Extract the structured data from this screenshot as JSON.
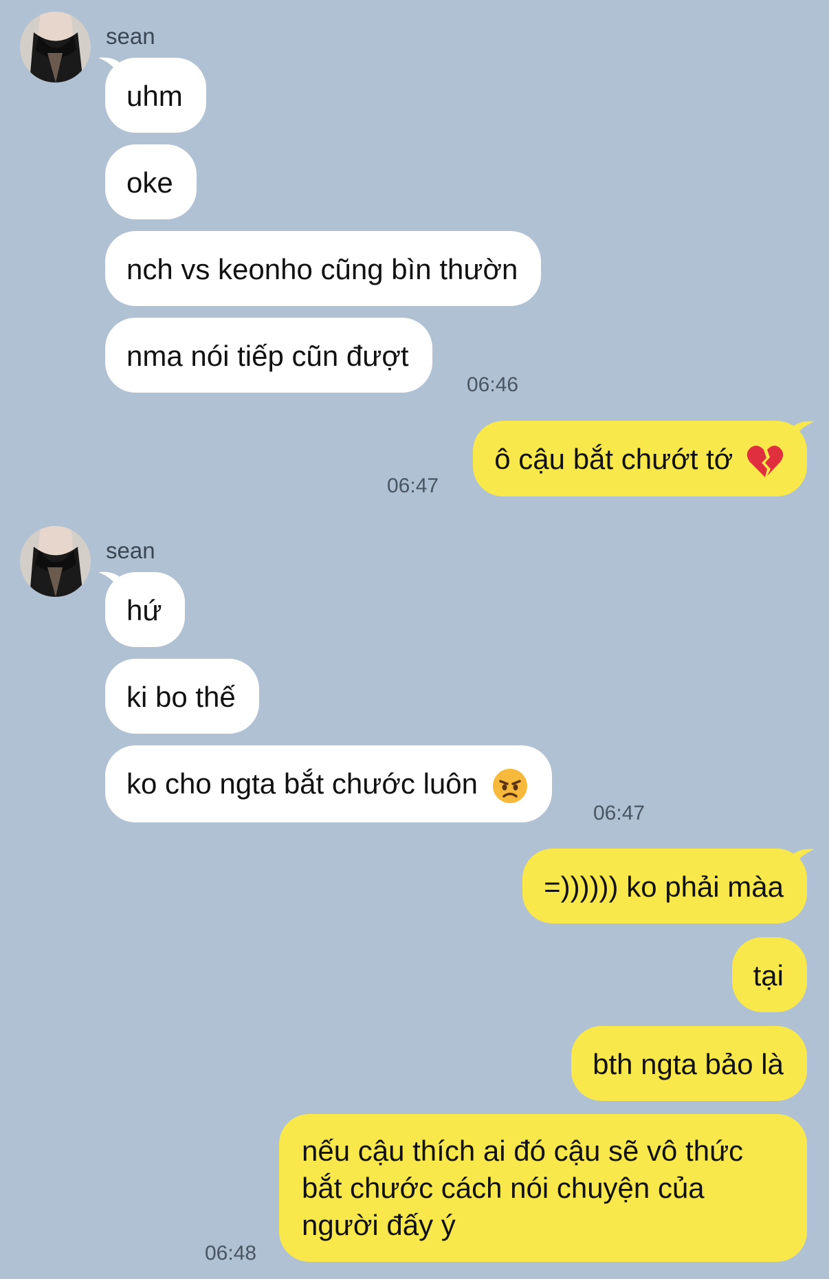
{
  "contact": {
    "name": "sean"
  },
  "groups": [
    {
      "messages": [
        "uhm",
        "oke",
        "nch vs keonho cũng bìn thườn",
        "nma nói tiếp cũn đượt"
      ],
      "time": "06:46"
    },
    {
      "messages": [
        "ô cậu bắt chướt tớ"
      ],
      "emoji": "broken-heart-icon",
      "time": "06:47"
    },
    {
      "messages": [
        "hứ",
        "ki bo thế",
        "ko cho ngta bắt chước luôn"
      ],
      "emoji": "angry-face-icon",
      "time": "06:47"
    },
    {
      "messages": [
        "=)))))) ko phải màa",
        "tại",
        "bth ngta bảo là"
      ],
      "time": "06:48"
    }
  ],
  "last_message_lines": [
    "nếu cậu thích ai đó cậu sẽ vô thức",
    "bắt chước cách nói chuyện của",
    "người đấy ý"
  ],
  "colors": {
    "background": "#afc1d2",
    "incoming": "#ffffff",
    "outgoing": "#f8e84c"
  }
}
